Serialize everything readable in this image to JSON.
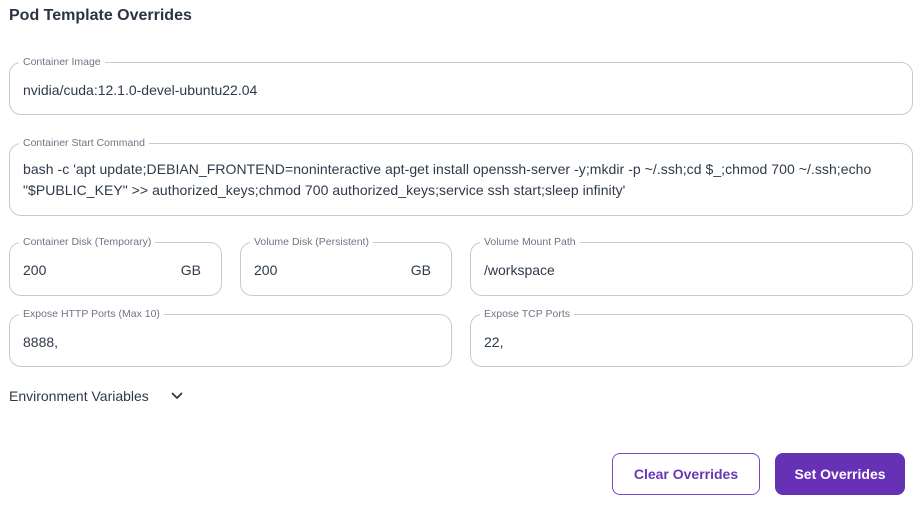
{
  "title": "Pod Template Overrides",
  "fields": {
    "container_image": {
      "label": "Container Image",
      "value": "nvidia/cuda:12.1.0-devel-ubuntu22.04"
    },
    "start_command": {
      "label": "Container Start Command",
      "value": "bash -c 'apt update;DEBIAN_FRONTEND=noninteractive apt-get install openssh-server -y;mkdir -p ~/.ssh;cd $_;chmod 700 ~/.ssh;echo \"$PUBLIC_KEY\" >> authorized_keys;chmod 700 authorized_keys;service ssh start;sleep infinity'"
    },
    "container_disk": {
      "label": "Container Disk (Temporary)",
      "value": "200",
      "unit": "GB"
    },
    "volume_disk": {
      "label": "Volume Disk (Persistent)",
      "value": "200",
      "unit": "GB"
    },
    "volume_mount": {
      "label": "Volume Mount Path",
      "value": "/workspace"
    },
    "http_ports": {
      "label": "Expose HTTP Ports (Max 10)",
      "value": "8888,"
    },
    "tcp_ports": {
      "label": "Expose TCP Ports",
      "value": "22,"
    }
  },
  "env_vars": {
    "label": "Environment Variables",
    "icon": "chevron-down-icon"
  },
  "buttons": {
    "clear": "Clear Overrides",
    "set": "Set Overrides"
  },
  "colors": {
    "accent": "#6731b5",
    "border": "#c6cbd3",
    "text": "#2f3a4a"
  }
}
